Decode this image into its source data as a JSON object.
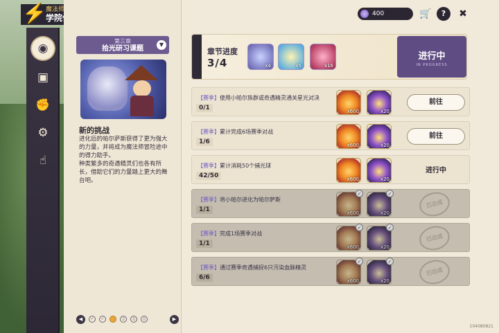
{
  "app": {
    "logo_char": "🗲",
    "title_top": "魔法师手册",
    "title_main": "学院作业"
  },
  "rail": [
    {
      "name": "task-book-icon",
      "glyph": "◉",
      "active": true
    },
    {
      "name": "card-icon",
      "glyph": "▣"
    },
    {
      "name": "fist-icon",
      "glyph": "✊"
    },
    {
      "name": "gear-icon",
      "glyph": "⚙"
    },
    {
      "name": "hand-icon",
      "glyph": "☝"
    }
  ],
  "chapter": {
    "sub": "第三章",
    "title": "拾光研习课题",
    "drop": "▼"
  },
  "challenge": {
    "title": "新的挑战",
    "text": "进化后的帕尔萨斯获得了更为强大的力量，并将成为魔法师冒险途中的得力助手。\n种类繁多的奇遇精灵们也各有所长，借助它们的力量踏上更大的舞台吧。"
  },
  "pager": {
    "left": "◀",
    "right": "▶"
  },
  "header": {
    "currency": "400",
    "shop": "🛒",
    "help": "?",
    "close": "✖"
  },
  "progress": {
    "label": "章节进度",
    "value": "3/4",
    "rewards": [
      {
        "name": "crystal-reward-icon",
        "qty": "x4"
      },
      {
        "name": "eye-reward-icon",
        "qty": "x5"
      },
      {
        "name": "gem-reward-icon",
        "qty": "x16"
      }
    ],
    "status": "进行中",
    "status_sub": "IN PROGRESS"
  },
  "tasks": [
    {
      "tag": "【赛季】",
      "desc": "使用小帕尔族群或奇遇精灵通关星光对决",
      "count": "0/1",
      "fire_qty": "x600",
      "orb_qty": "x20",
      "state": "go",
      "action": "前往"
    },
    {
      "tag": "【赛季】",
      "desc": "累计完成6场赛季对战",
      "count": "1/6",
      "fire_qty": "x600",
      "orb_qty": "x20",
      "state": "go",
      "action": "前往"
    },
    {
      "tag": "【赛季】",
      "desc": "累计消耗50个捕光球",
      "count": "42/50",
      "fire_qty": "x600",
      "orb_qty": "x20",
      "state": "progress",
      "action": "进行中"
    },
    {
      "tag": "【赛季】",
      "desc": "将小帕尔进化为帕尔萨斯",
      "count": "1/1",
      "fire_qty": "x600",
      "orb_qty": "x20",
      "state": "done",
      "action": "已达成"
    },
    {
      "tag": "【赛季】",
      "desc": "完成1场赛季对战",
      "count": "1/1",
      "fire_qty": "x600",
      "orb_qty": "x20",
      "state": "done",
      "action": "已达成"
    },
    {
      "tag": "【赛季】",
      "desc": "通过赛季奇遇捕捉6只污染血脉精灵",
      "count": "6/6",
      "fire_qty": "x600",
      "orb_qty": "x20",
      "state": "done",
      "action": "已达成"
    }
  ],
  "uid": "104080821"
}
